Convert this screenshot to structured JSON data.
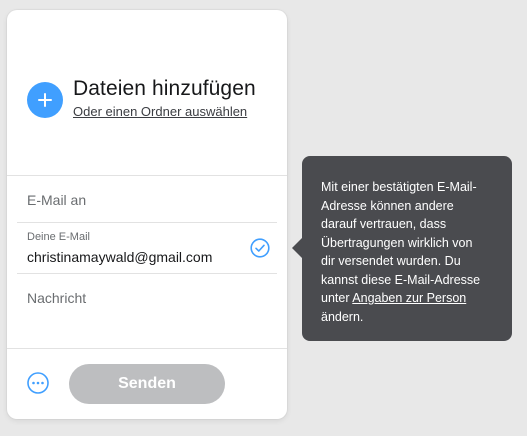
{
  "upload": {
    "title": "Dateien hinzufügen",
    "folder_link": "Oder einen Ordner auswählen"
  },
  "form": {
    "email_to_placeholder": "E-Mail an",
    "my_email_label": "Deine E-Mail",
    "my_email_value": "christinamaywald@gmail.com",
    "message_placeholder": "Nachricht"
  },
  "footer": {
    "send_label": "Senden"
  },
  "tooltip": {
    "line1": "Mit einer bestätigten E-Mail-",
    "line2": "Adresse können andere",
    "line3": "darauf vertrauen, dass",
    "line4": "Übertragungen wirklich von",
    "line5": "dir versendet wurden. Du",
    "line6": "kannst diese E-Mail-Adresse",
    "line7_prefix": "unter ",
    "line7_link": "Angaben zur Person",
    "line8": "ändern."
  },
  "icons": {
    "add": "plus-icon",
    "verified": "check-circle-icon",
    "more": "more-options-icon"
  },
  "colors": {
    "accent_blue": "#409fff",
    "tooltip_bg": "#4a4b4f",
    "send_disabled": "#bdbec0"
  }
}
